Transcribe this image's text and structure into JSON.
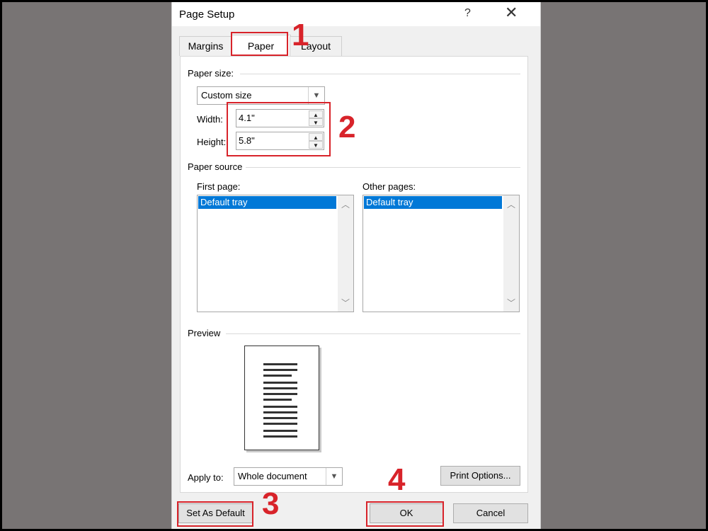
{
  "dialog": {
    "title": "Page Setup",
    "help_label": "?",
    "close_label": "✕"
  },
  "tabs": [
    {
      "label": "Margins",
      "active": false
    },
    {
      "label": "Paper",
      "active": true
    },
    {
      "label": "Layout",
      "active": false
    }
  ],
  "paper_size": {
    "group_label": "Paper size:",
    "selected": "Custom size",
    "width_label": "Width:",
    "width_value": "4.1\"",
    "height_label": "Height:",
    "height_value": "5.8\""
  },
  "paper_source": {
    "group_label": "Paper source",
    "first_page_label": "First page:",
    "first_page_selected": "Default tray",
    "other_pages_label": "Other pages:",
    "other_pages_selected": "Default tray"
  },
  "preview": {
    "group_label": "Preview"
  },
  "apply_to": {
    "label": "Apply to:",
    "selected": "Whole document"
  },
  "buttons": {
    "print_options": "Print Options...",
    "set_as_default": "Set As Default",
    "ok": "OK",
    "cancel": "Cancel"
  },
  "annotations": {
    "step1": "1",
    "step2": "2",
    "step3": "3",
    "step4": "4",
    "color": "#d8232a"
  }
}
